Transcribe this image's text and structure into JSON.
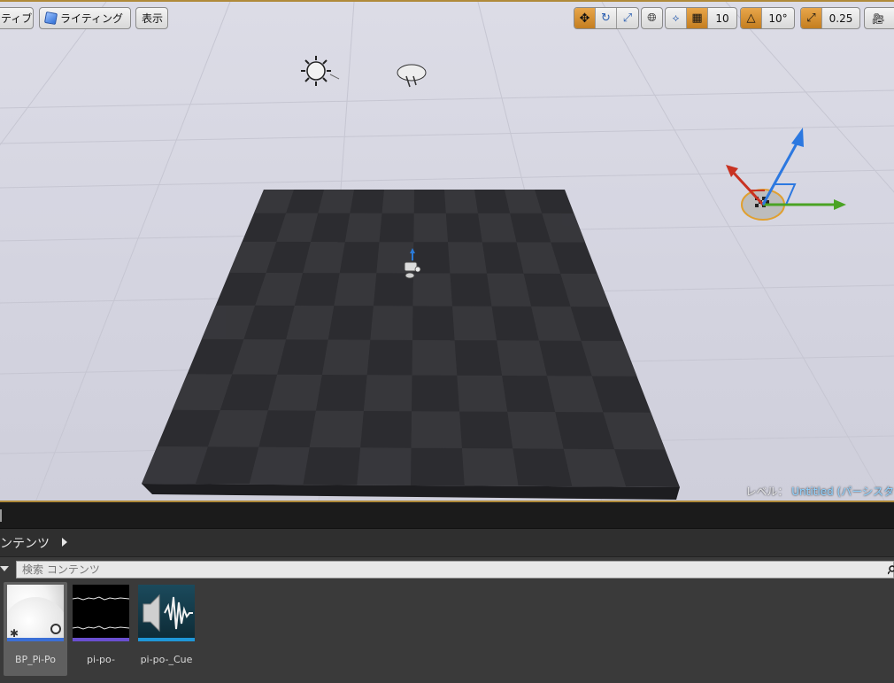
{
  "toolbar": {
    "perspective_label": "ティブ",
    "lighting_label": "ライティング",
    "show_label": "表示",
    "grid_snap_value": "10",
    "rotation_snap_value": "10°",
    "scale_snap_value": "0.25"
  },
  "viewport": {
    "level_prefix": "レベル：",
    "level_name": "Untitled (パーシスタ"
  },
  "content_browser": {
    "title": "ンテンツ",
    "search_placeholder": "検索 コンテンツ",
    "assets": [
      {
        "label": "BP_Pi-Po",
        "selected": true,
        "bar_color": "#3b6fd6",
        "icon": "sphere-thumbnail-icon"
      },
      {
        "label": "pi-po-",
        "selected": false,
        "bar_color": "#6a4fd0",
        "icon": "sound-wave-thumbnail-icon"
      },
      {
        "label": "pi-po-_Cue",
        "selected": false,
        "bar_color": "#1f97d8",
        "icon": "sound-cue-thumbnail-icon"
      }
    ]
  },
  "colors": {
    "accent_orange": "#c47e20",
    "gizmo_x": "#c83222",
    "gizmo_y": "#4aa324",
    "gizmo_z": "#2c78e0"
  }
}
